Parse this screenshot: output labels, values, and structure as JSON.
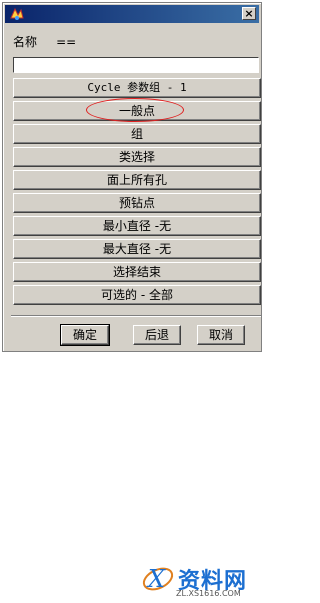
{
  "titlebar": {
    "close_label": "×"
  },
  "name_row": {
    "label": "名称",
    "separator": "==",
    "value": ""
  },
  "buttons": [
    {
      "label": "Cycle 参数组 - 1"
    },
    {
      "label": "一般点"
    },
    {
      "label": "组"
    },
    {
      "label": "类选择"
    },
    {
      "label": "面上所有孔"
    },
    {
      "label": "预钻点"
    },
    {
      "label": "最小直径 -无"
    },
    {
      "label": "最大直径 -无"
    },
    {
      "label": "选择结束"
    },
    {
      "label": "可选的 - 全部"
    }
  ],
  "footer": {
    "ok_label": "确定",
    "back_label": "后退",
    "cancel_label": "取消"
  },
  "watermark": {
    "brand": "资料网",
    "url": "ZL.XS1616.COM"
  },
  "colors": {
    "dialog_bg": "#d4d0c8",
    "title_start": "#0a246a",
    "title_end": "#3a6ea5",
    "annotation": "#e02020",
    "watermark": "#1c6fd1"
  }
}
